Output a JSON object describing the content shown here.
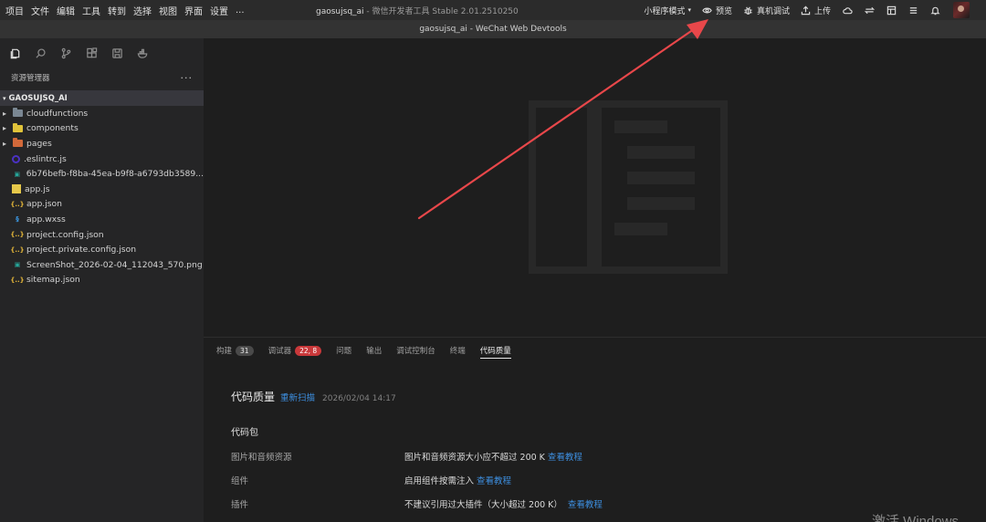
{
  "menu": [
    "项目",
    "文件",
    "编辑",
    "工具",
    "转到",
    "选择",
    "视图",
    "界面",
    "设置",
    "..."
  ],
  "app_title": {
    "project": "gaosujsq_ai",
    "separator": " - ",
    "tool": "微信开发者工具 Stable 2.01.2510250"
  },
  "toolbar": {
    "mode_label": "小程序模式",
    "preview_label": "预览",
    "realdevice_label": "真机调试",
    "upload_label": "上传"
  },
  "window_title": "gaosujsq_ai - WeChat Web Devtools",
  "explorer": {
    "title": "资源管理器",
    "more": "···",
    "project_name": "GAOSUJSQ_AI",
    "items": [
      {
        "name": "cloudfunctions",
        "kind": "folder",
        "color": "#7a8793"
      },
      {
        "name": "components",
        "kind": "folder",
        "color": "#e0c33a"
      },
      {
        "name": "pages",
        "kind": "folder",
        "color": "#d2693a"
      },
      {
        "name": ".eslintrc.js",
        "kind": "eslint"
      },
      {
        "name": "6b76befb-f8ba-45ea-b9f8-a6793db3589...",
        "kind": "image"
      },
      {
        "name": "app.js",
        "kind": "js"
      },
      {
        "name": "app.json",
        "kind": "json"
      },
      {
        "name": "app.wxss",
        "kind": "css"
      },
      {
        "name": "project.config.json",
        "kind": "json"
      },
      {
        "name": "project.private.config.json",
        "kind": "json"
      },
      {
        "name": "ScreenShot_2026-02-04_112043_570.png",
        "kind": "image"
      },
      {
        "name": "sitemap.json",
        "kind": "json"
      }
    ]
  },
  "panel": {
    "tabs": [
      {
        "label": "构建",
        "badge": "31",
        "badge_color": "gray"
      },
      {
        "label": "调试器",
        "badge": "22, 8",
        "badge_color": "red"
      },
      {
        "label": "问题"
      },
      {
        "label": "输出"
      },
      {
        "label": "调试控制台"
      },
      {
        "label": "终端"
      },
      {
        "label": "代码质量",
        "active": true
      }
    ]
  },
  "quality": {
    "title": "代码质量",
    "rescan": "重新扫描",
    "time": "2026/02/04 14:17",
    "section": "代码包",
    "rows": [
      {
        "label": "图片和音频资源",
        "desc": "图片和音频资源大小应不超过 200 K",
        "link": "查看教程"
      },
      {
        "label": "组件",
        "desc": "启用组件按需注入",
        "link": "查看教程"
      },
      {
        "label": "插件",
        "desc": "不建议引用过大插件（大小超过 200 K）",
        "link": "查看教程"
      }
    ]
  },
  "watermark": "激活 Windows",
  "colors": {
    "accent_link": "#3d8fe0",
    "badge_red": "#c9383a",
    "arrow": "#e8474a"
  }
}
